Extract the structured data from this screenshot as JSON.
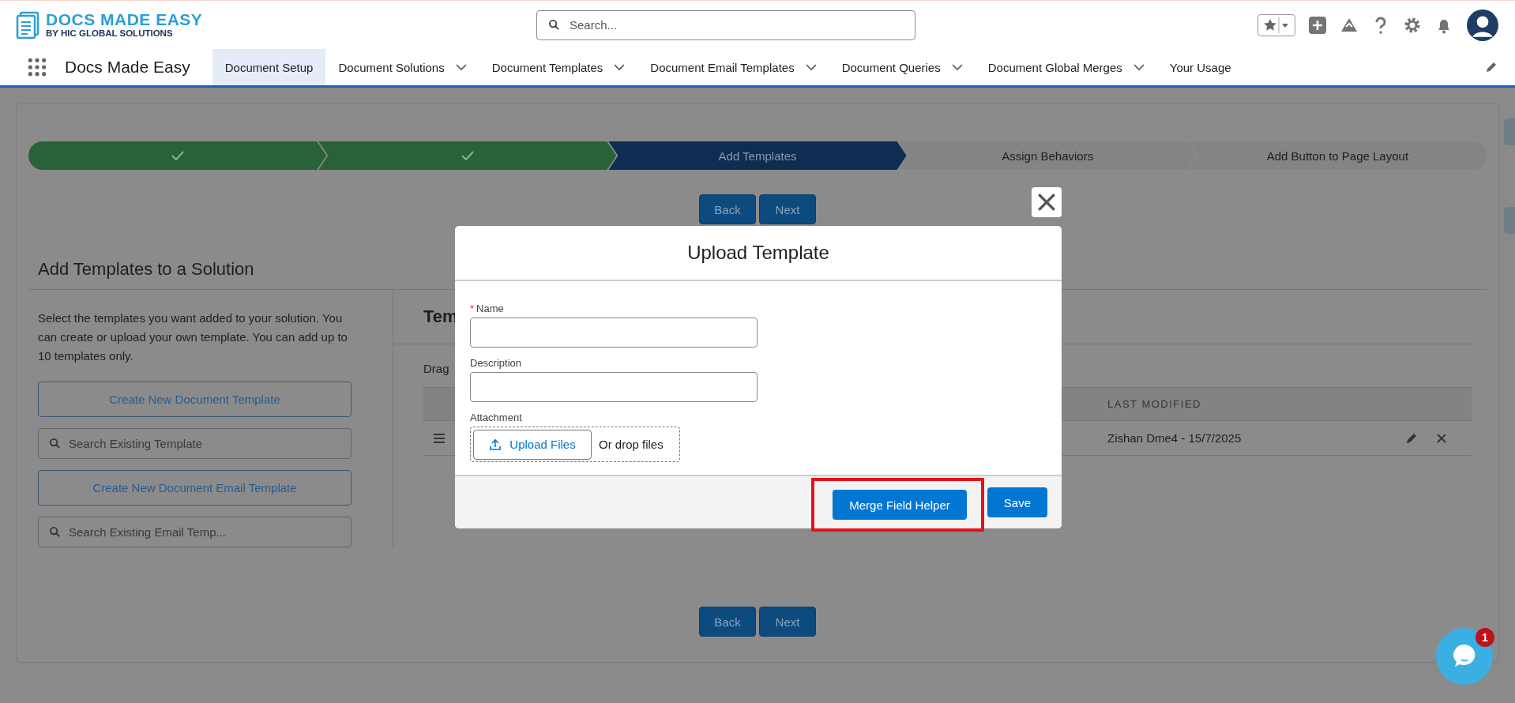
{
  "header": {
    "logo": {
      "title": "DOCS MADE EASY",
      "subtitle": "BY HIC GLOBAL SOLUTIONS"
    },
    "search": {
      "placeholder": "Search..."
    }
  },
  "nav": {
    "app_name": "Docs Made Easy",
    "tabs": [
      {
        "label": "Document Setup",
        "selected": true,
        "dropdown": false
      },
      {
        "label": "Document Solutions",
        "selected": false,
        "dropdown": true
      },
      {
        "label": "Document Templates",
        "selected": false,
        "dropdown": true
      },
      {
        "label": "Document Email Templates",
        "selected": false,
        "dropdown": true
      },
      {
        "label": "Document Queries",
        "selected": false,
        "dropdown": true
      },
      {
        "label": "Document Global Merges",
        "selected": false,
        "dropdown": true
      },
      {
        "label": "Your Usage",
        "selected": false,
        "dropdown": false
      }
    ]
  },
  "stepper": [
    {
      "completed": true,
      "selected": false
    },
    {
      "completed": true,
      "selected": false
    },
    {
      "label": "Add Templates",
      "completed": false,
      "selected": true
    },
    {
      "label": "Assign Behaviors",
      "completed": false,
      "selected": false
    },
    {
      "label": "Add Button to Page Layout",
      "completed": false,
      "selected": false
    }
  ],
  "top_buttons": [
    "Back",
    "Next"
  ],
  "left_panel": {
    "title": "Add Templates to a Solution",
    "description": "Select the templates you want added to your solution. You can create or upload your own template. You can add up to 10 templates only.",
    "actions": [
      {
        "kind": "button",
        "label": "Create New Document Template"
      },
      {
        "kind": "search",
        "placeholder": "Search Existing Template"
      },
      {
        "kind": "button",
        "label": "Create New Document Email Template"
      },
      {
        "kind": "search",
        "placeholder": "Search Existing Email Temp..."
      }
    ]
  },
  "templates": {
    "heading": "Tem",
    "hint": "Drag",
    "columns": [
      "LAST MODIFIED"
    ],
    "rows": [
      {
        "last_modified": "Zishan Dme4 - 15/7/2025"
      }
    ]
  },
  "bottom_buttons": [
    "Back",
    "Next"
  ],
  "modal": {
    "title": "Upload Template",
    "fields": [
      {
        "marker": "*",
        "label": "Name"
      },
      {
        "label": "Description"
      }
    ],
    "attachment": {
      "label": "Attachment",
      "button": "Upload Files",
      "hint": "Or drop files"
    },
    "buttons": [
      {
        "label": "Merge Field Helper",
        "highlighted": true
      },
      {
        "label": "Save",
        "highlighted": false
      }
    ]
  },
  "chat": {
    "badge": "1"
  }
}
